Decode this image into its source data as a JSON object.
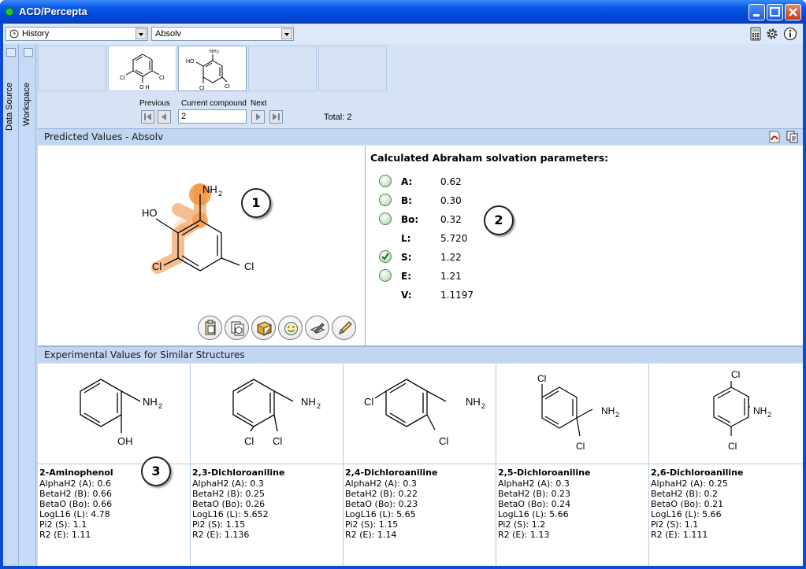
{
  "window": {
    "title": "ACD/Percepta"
  },
  "toolbar": {
    "history_label": "History",
    "module_value": "Absolv",
    "icons": [
      "calculator-icon",
      "gear-icon",
      "info-icon"
    ]
  },
  "sidebar": {
    "data_source": "Data Source",
    "workspace": "Workspace"
  },
  "navigator": {
    "previous_label": "Previous",
    "current_label": "Current compound",
    "next_label": "Next",
    "current_value": "2",
    "total_text": "Total: 2",
    "thumb1": {
      "labels": [
        "Cl",
        "Cl",
        "O H"
      ]
    },
    "thumb2": {
      "labels": [
        "NH",
        "2",
        "HO",
        "Cl",
        "Cl"
      ]
    }
  },
  "predicted": {
    "header": "Predicted Values - Absolv",
    "structure_labels": {
      "nh2": "NH",
      "nh2_sub": "2",
      "ho": "HO",
      "cl1": "Cl",
      "cl2": "Cl"
    },
    "callout": "1",
    "title": "Calculated Abraham solvation parameters:",
    "params": [
      {
        "name": "A:",
        "value": "0.62",
        "radio": "unchecked"
      },
      {
        "name": "B:",
        "value": "0.30",
        "radio": "unchecked"
      },
      {
        "name": "Bo:",
        "value": "0.32",
        "radio": "unchecked"
      },
      {
        "name": "L:",
        "value": "5.720",
        "radio": "none"
      },
      {
        "name": "S:",
        "value": "1.22",
        "radio": "checked"
      },
      {
        "name": "E:",
        "value": "1.21",
        "radio": "unchecked"
      },
      {
        "name": "V:",
        "value": "1.1197",
        "radio": "none"
      }
    ],
    "callout2": "2"
  },
  "experimental": {
    "header": "Experimental Values for Similar Structures",
    "callout": "3",
    "compounds": [
      {
        "name": "2-Aminophenol",
        "lines": [
          "AlphaH2 (A): 0.6",
          "BetaH2 (B): 0.66",
          "BetaO (Bo): 0.66",
          "LogL16 (L): 4.78",
          "Pi2 (S): 1.1",
          "R2 (E): 1.11"
        ]
      },
      {
        "name": "2,3-Dichloroaniline",
        "lines": [
          "AlphaH2 (A): 0.3",
          "BetaH2 (B): 0.25",
          "BetaO (Bo): 0.26",
          "LogL16 (L): 5.652",
          "Pi2 (S): 1.15",
          "R2 (E): 1.136"
        ]
      },
      {
        "name": "2,4-Dichloroaniline",
        "lines": [
          "AlphaH2 (A): 0.3",
          "BetaH2 (B): 0.22",
          "BetaO (Bo): 0.23",
          "LogL16 (L): 5.65",
          "Pi2 (S): 1.15",
          "R2 (E): 1.14"
        ]
      },
      {
        "name": "2,5-Dichloroaniline",
        "lines": [
          "AlphaH2 (A): 0.3",
          "BetaH2 (B): 0.23",
          "BetaO (Bo): 0.24",
          "LogL16 (L): 5.66",
          "Pi2 (S): 1.2",
          "R2 (E): 1.13"
        ]
      },
      {
        "name": "2,6-Dichloroaniline",
        "lines": [
          "AlphaH2 (A): 0.25",
          "BetaH2 (B): 0.2",
          "BetaO (Bo): 0.21",
          "LogL16 (L): 5.66",
          "Pi2 (S): 1.1",
          "R2 (E): 1.111"
        ]
      }
    ],
    "struct_labels": {
      "c1": {
        "nh": "NH",
        "sub": "2",
        "oh": "OH"
      },
      "c2": {
        "nh": "NH",
        "sub": "2",
        "cl1": "Cl",
        "cl2": "Cl"
      },
      "c3": {
        "nh": "NH",
        "sub": "2",
        "cl1": "Cl",
        "cl2": "Cl"
      },
      "c4": {
        "nh": "NH",
        "sub": "2",
        "cl1": "Cl",
        "cl2": "Cl"
      },
      "c5": {
        "nh": "NH",
        "sub": "2",
        "cl1": "Cl",
        "cl2": "Cl"
      }
    }
  }
}
